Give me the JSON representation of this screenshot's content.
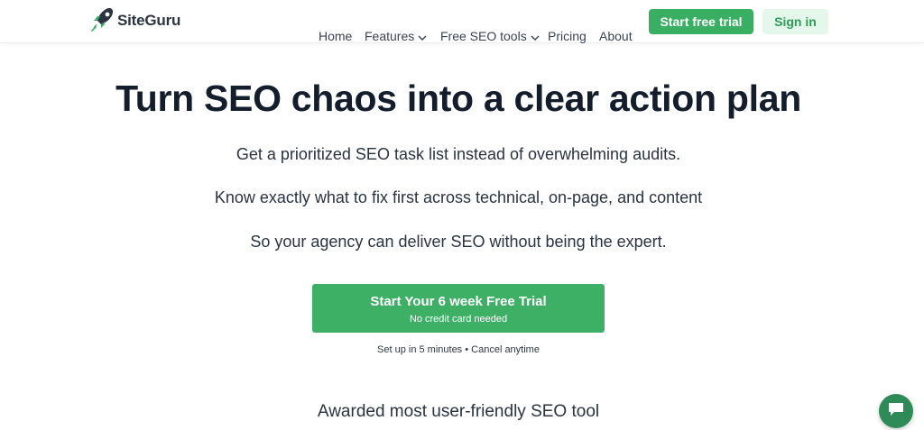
{
  "brand": {
    "name": "SiteGuru",
    "logo_icon": "rocket-icon",
    "accent": "#3aae63"
  },
  "nav": {
    "home": "Home",
    "features": "Features",
    "free_tools": "Free SEO tools",
    "pricing": "Pricing",
    "about": "About",
    "start_trial": "Start free trial",
    "sign_in": "Sign in"
  },
  "hero": {
    "title": "Turn SEO chaos into a clear action plan",
    "line1": "Get a prioritized SEO task list instead of overwhelming audits.",
    "line2": "Know exactly what to fix first across technical, on-page, and content",
    "line3": "So your agency can deliver SEO without being the expert.",
    "cta_label": "Start Your 6 week Free Trial",
    "cta_sub": "No credit card needed",
    "setup_note": "Set up in 5 minutes • Cancel anytime",
    "awarded": "Awarded most user-friendly SEO tool"
  },
  "chat": {
    "icon": "chat-bubble-icon"
  }
}
